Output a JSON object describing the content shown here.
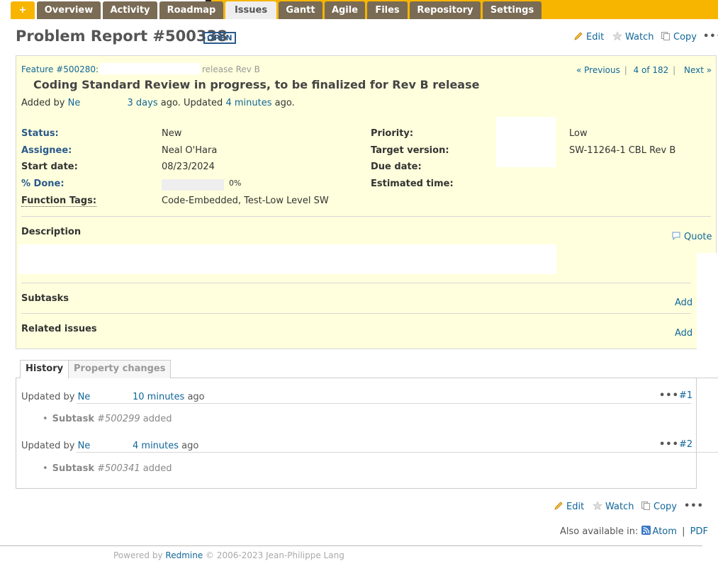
{
  "menu": {
    "plus": "+",
    "tabs": [
      "Overview",
      "Activity",
      "Roadmap",
      "Issues",
      "Gantt",
      "Agile",
      "Files",
      "Repository",
      "Settings"
    ],
    "selected": "Issues",
    "accent": "#f7b500",
    "tab_color": "#7a6b55"
  },
  "header": {
    "title": "Problem Report #500338",
    "status": "OPEN",
    "actions": {
      "edit": "Edit",
      "watch": "Watch",
      "copy": "Copy",
      "more": "•••"
    }
  },
  "issue": {
    "parent_link": "Feature #500280:",
    "parent_suffix": "release Rev B",
    "nav": {
      "previous": "« Previous",
      "sep1": "|",
      "position": "4 of 182",
      "sep2": "|",
      "next": "Next »"
    },
    "subject": "Coding Standard Review in progress, to be finalized for Rev B release",
    "added_by_prefix": "Added by",
    "author_short": "Ne",
    "created": "3 days",
    "ago_updated": "ago. Updated",
    "updated": "4 minutes",
    "ago": "ago.",
    "attributes": {
      "status_label": "Status:",
      "status_value": "New",
      "assignee_label": "Assignee:",
      "assignee_value": "Neal O'Hara",
      "start_label": "Start date:",
      "start_value": "08/23/2024",
      "done_label": "% Done:",
      "done_value": "0%",
      "done_percent": 0,
      "tags_label": "Function Tags:",
      "tags_value": "Code-Embedded, Test-Low Level SW",
      "priority_label": "Priority:",
      "priority_value": "Low",
      "target_label": "Target version:",
      "target_value": "SW-11264-1 CBL Rev B",
      "due_label": "Due date:",
      "due_value": "",
      "estimated_label": "Estimated time:",
      "estimated_value": ""
    },
    "description_label": "Description",
    "quote": "Quote",
    "subtasks_label": "Subtasks",
    "related_label": "Related issues",
    "add": "Add"
  },
  "history": {
    "tabs": [
      "History",
      "Property changes"
    ],
    "entries": [
      {
        "prefix": "Updated by",
        "author": "Ne",
        "time": "10 minutes",
        "ago": "ago",
        "num": "#1",
        "detail_label": "Subtask",
        "detail_ref": "#500299",
        "detail_action": "added"
      },
      {
        "prefix": "Updated by",
        "author": "Ne",
        "time": "4 minutes",
        "ago": "ago",
        "num": "#2",
        "detail_label": "Subtask",
        "detail_ref": "#500341",
        "detail_action": "added"
      }
    ]
  },
  "footer_actions": {
    "edit": "Edit",
    "watch": "Watch",
    "copy": "Copy",
    "more": "•••"
  },
  "other_formats": {
    "label": "Also available in:",
    "atom": "Atom",
    "sep": "|",
    "pdf": "PDF"
  },
  "footer": {
    "powered": "Powered by",
    "redmine": "Redmine",
    "copyright": "© 2006-2023 Jean-Philippe Lang"
  }
}
